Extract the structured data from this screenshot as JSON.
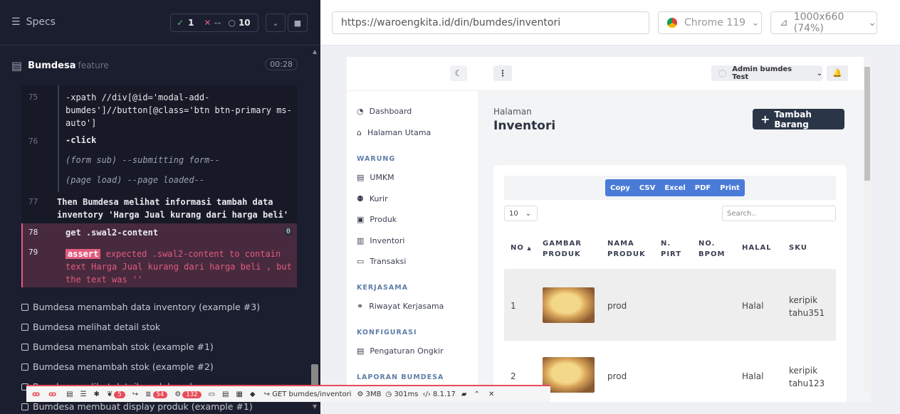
{
  "runner": {
    "specs_label": "Specs",
    "passed": "1",
    "failed": "--",
    "pending": "10",
    "spec_name": "Bumdesa",
    "spec_type": "feature",
    "duration": "00:28",
    "commands": [
      {
        "line": "75",
        "text": "-xpath  //div[@id='modal-add-bumdes']//button[@class='btn btn-primary ms-auto']"
      },
      {
        "line": "76",
        "text": "-click"
      },
      {
        "line": "",
        "text": "(form sub)  --submitting form--"
      },
      {
        "line": "",
        "text": "(page load)  --page loaded--"
      },
      {
        "line": "77",
        "text": "Then  Bumdesa melihat informasi tambah data inventory 'Harga Jual kurang dari harga beli'"
      },
      {
        "line": "78",
        "text": "get  .swal2-content",
        "count": "0"
      },
      {
        "line": "79",
        "text": "expected  .swal2-content to contain text  Harga Jual kurang dari harga beli , but the text was  ''",
        "tag": "assert"
      }
    ],
    "tests": [
      "Bumdesa menambah data inventory (example #3)",
      "Bumdesa melihat detail stok",
      "Bumdesa menambah stok (example #1)",
      "Bumdesa menambah stok (example #2)",
      "Bumdesa melihat detail produk umkm",
      "Bumdesa membuat display produk (example #1)"
    ]
  },
  "browser": {
    "url": "https://waroengkita.id/din/bumdes/inventori",
    "browser_name": "Chrome 119",
    "viewport": "1000x660  (74%)"
  },
  "app": {
    "user": "Admin bumdes Test",
    "nav": {
      "dashboard": "Dashboard",
      "home": "Halaman Utama",
      "group_warung": "WARUNG",
      "umkm": "UMKM",
      "kurir": "Kurir",
      "produk": "Produk",
      "inventori": "Inventori",
      "transaksi": "Transaksi",
      "group_kerjasama": "KERJASAMA",
      "riwayat": "Riwayat Kerjasama",
      "group_konfigurasi": "KONFIGURASI",
      "ongkir": "Pengaturan Ongkir",
      "group_laporan": "LAPORAN BUMDESA"
    },
    "breadcrumb": "Halaman",
    "page_title": "Inventori",
    "add_button": "Tambah Barang",
    "export_buttons": [
      "Copy",
      "CSV",
      "Excel",
      "PDF",
      "Print"
    ],
    "page_size": "10",
    "search_placeholder": "Search..",
    "columns": [
      "NO",
      "GAMBAR PRODUK",
      "NAMA PRODUK",
      "N. PIRT",
      "NO. BPOM",
      "HALAL",
      "SKU"
    ],
    "rows": [
      {
        "no": "1",
        "name": "prod",
        "halal": "Halal",
        "sku": "keripik tahu351"
      },
      {
        "no": "2",
        "name": "prod",
        "halal": "Halal",
        "sku": "keripik tahu123"
      }
    ]
  },
  "debugbar": {
    "b1": "5",
    "b2": "54",
    "b3": "132",
    "route": "GET bumdes/inventori",
    "mem": "3MB",
    "time": "301ms",
    "php": "8.1.17"
  }
}
